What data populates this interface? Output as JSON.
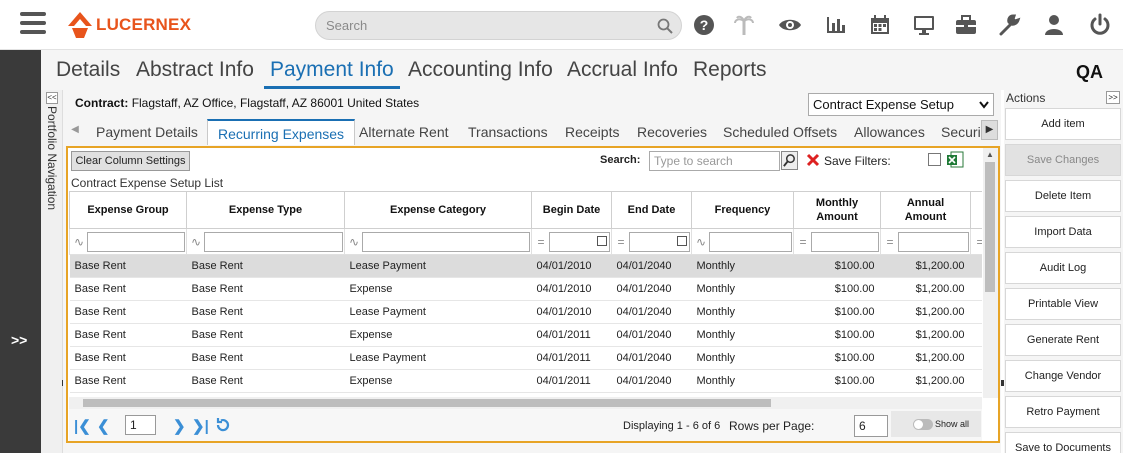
{
  "app": {
    "logo_text": "LUCERNEX",
    "search_placeholder": "Search",
    "environment": "QA",
    "top_icons": [
      "help-icon",
      "palm-tree-icon",
      "eye-icon",
      "bar-chart-icon",
      "calendar-icon",
      "monitor-icon",
      "briefcase-icon",
      "wrench-icon",
      "user-icon",
      "power-icon"
    ]
  },
  "leftstrip": {
    "expand_label": ">>"
  },
  "portfolio_nav": {
    "label": "Portfolio Navigation",
    "collapse_label": "<<"
  },
  "main_tabs": [
    {
      "label": "Details"
    },
    {
      "label": "Abstract Info"
    },
    {
      "label": "Payment Info",
      "active": true
    },
    {
      "label": "Accounting Info"
    },
    {
      "label": "Accrual Info"
    },
    {
      "label": "Reports"
    }
  ],
  "contract": {
    "label": "Contract:",
    "value": "Flagstaff, AZ Office, Flagstaff, AZ 86001 United States"
  },
  "setup_select": {
    "value": "Contract Expense Setup"
  },
  "sub_tabs": [
    {
      "label": "Payment Details"
    },
    {
      "label": "Recurring Expenses",
      "active": true
    },
    {
      "label": "Alternate Rent"
    },
    {
      "label": "Transactions"
    },
    {
      "label": "Receipts"
    },
    {
      "label": "Recoveries"
    },
    {
      "label": "Scheduled Offsets"
    },
    {
      "label": "Allowances"
    },
    {
      "label": "Securi"
    }
  ],
  "grid": {
    "clear_columns_label": "Clear Column Settings",
    "search_label": "Search:",
    "search_placeholder": "Type to search",
    "save_filters_label": "Save Filters:",
    "list_title": "Contract Expense Setup List",
    "columns": [
      {
        "label": "Expense Group"
      },
      {
        "label": "Expense Type"
      },
      {
        "label": "Expense Category"
      },
      {
        "label": "Begin Date"
      },
      {
        "label": "End Date"
      },
      {
        "label": "Frequency"
      },
      {
        "label": "Monthly Amount"
      },
      {
        "label": "Annual Amount"
      }
    ],
    "rows": [
      {
        "group": "Base Rent",
        "type": "Base Rent",
        "category": "Lease Payment",
        "begin": "04/01/2010",
        "end": "04/01/2040",
        "frequency": "Monthly",
        "monthly": "$100.00",
        "annual": "$1,200.00"
      },
      {
        "group": "Base Rent",
        "type": "Base Rent",
        "category": "Expense",
        "begin": "04/01/2010",
        "end": "04/01/2040",
        "frequency": "Monthly",
        "monthly": "$100.00",
        "annual": "$1,200.00"
      },
      {
        "group": "Base Rent",
        "type": "Base Rent",
        "category": "Lease Payment",
        "begin": "04/01/2010",
        "end": "04/01/2040",
        "frequency": "Monthly",
        "monthly": "$100.00",
        "annual": "$1,200.00"
      },
      {
        "group": "Base Rent",
        "type": "Base Rent",
        "category": "Expense",
        "begin": "04/01/2011",
        "end": "04/01/2040",
        "frequency": "Monthly",
        "monthly": "$100.00",
        "annual": "$1,200.00"
      },
      {
        "group": "Base Rent",
        "type": "Base Rent",
        "category": "Lease Payment",
        "begin": "04/01/2011",
        "end": "04/01/2040",
        "frequency": "Monthly",
        "monthly": "$100.00",
        "annual": "$1,200.00"
      },
      {
        "group": "Base Rent",
        "type": "Base Rent",
        "category": "Expense",
        "begin": "04/01/2011",
        "end": "04/01/2040",
        "frequency": "Monthly",
        "monthly": "$100.00",
        "annual": "$1,200.00"
      }
    ],
    "pager": {
      "page": "1",
      "display_text": "Displaying 1 - 6 of 6",
      "rows_per_page_label": "Rows per Page:",
      "rows_per_page": "6",
      "show_all_label": "Show all"
    }
  },
  "actions": {
    "title": "Actions",
    "collapse_label": ">>",
    "buttons": [
      {
        "label": "Add item"
      },
      {
        "label": "Save Changes",
        "disabled": true
      },
      {
        "label": "Delete Item"
      },
      {
        "label": "Import Data"
      },
      {
        "label": "Audit Log"
      },
      {
        "label": "Printable View"
      },
      {
        "label": "Generate Rent"
      },
      {
        "label": "Change Vendor"
      },
      {
        "label": "Retro Payment"
      },
      {
        "label": "Save to Documents"
      }
    ]
  },
  "colors": {
    "accent": "#1a6fb3",
    "brand": "#e8541c",
    "grid_border": "#e7a426",
    "dark_strip": "#3a3a3a"
  }
}
